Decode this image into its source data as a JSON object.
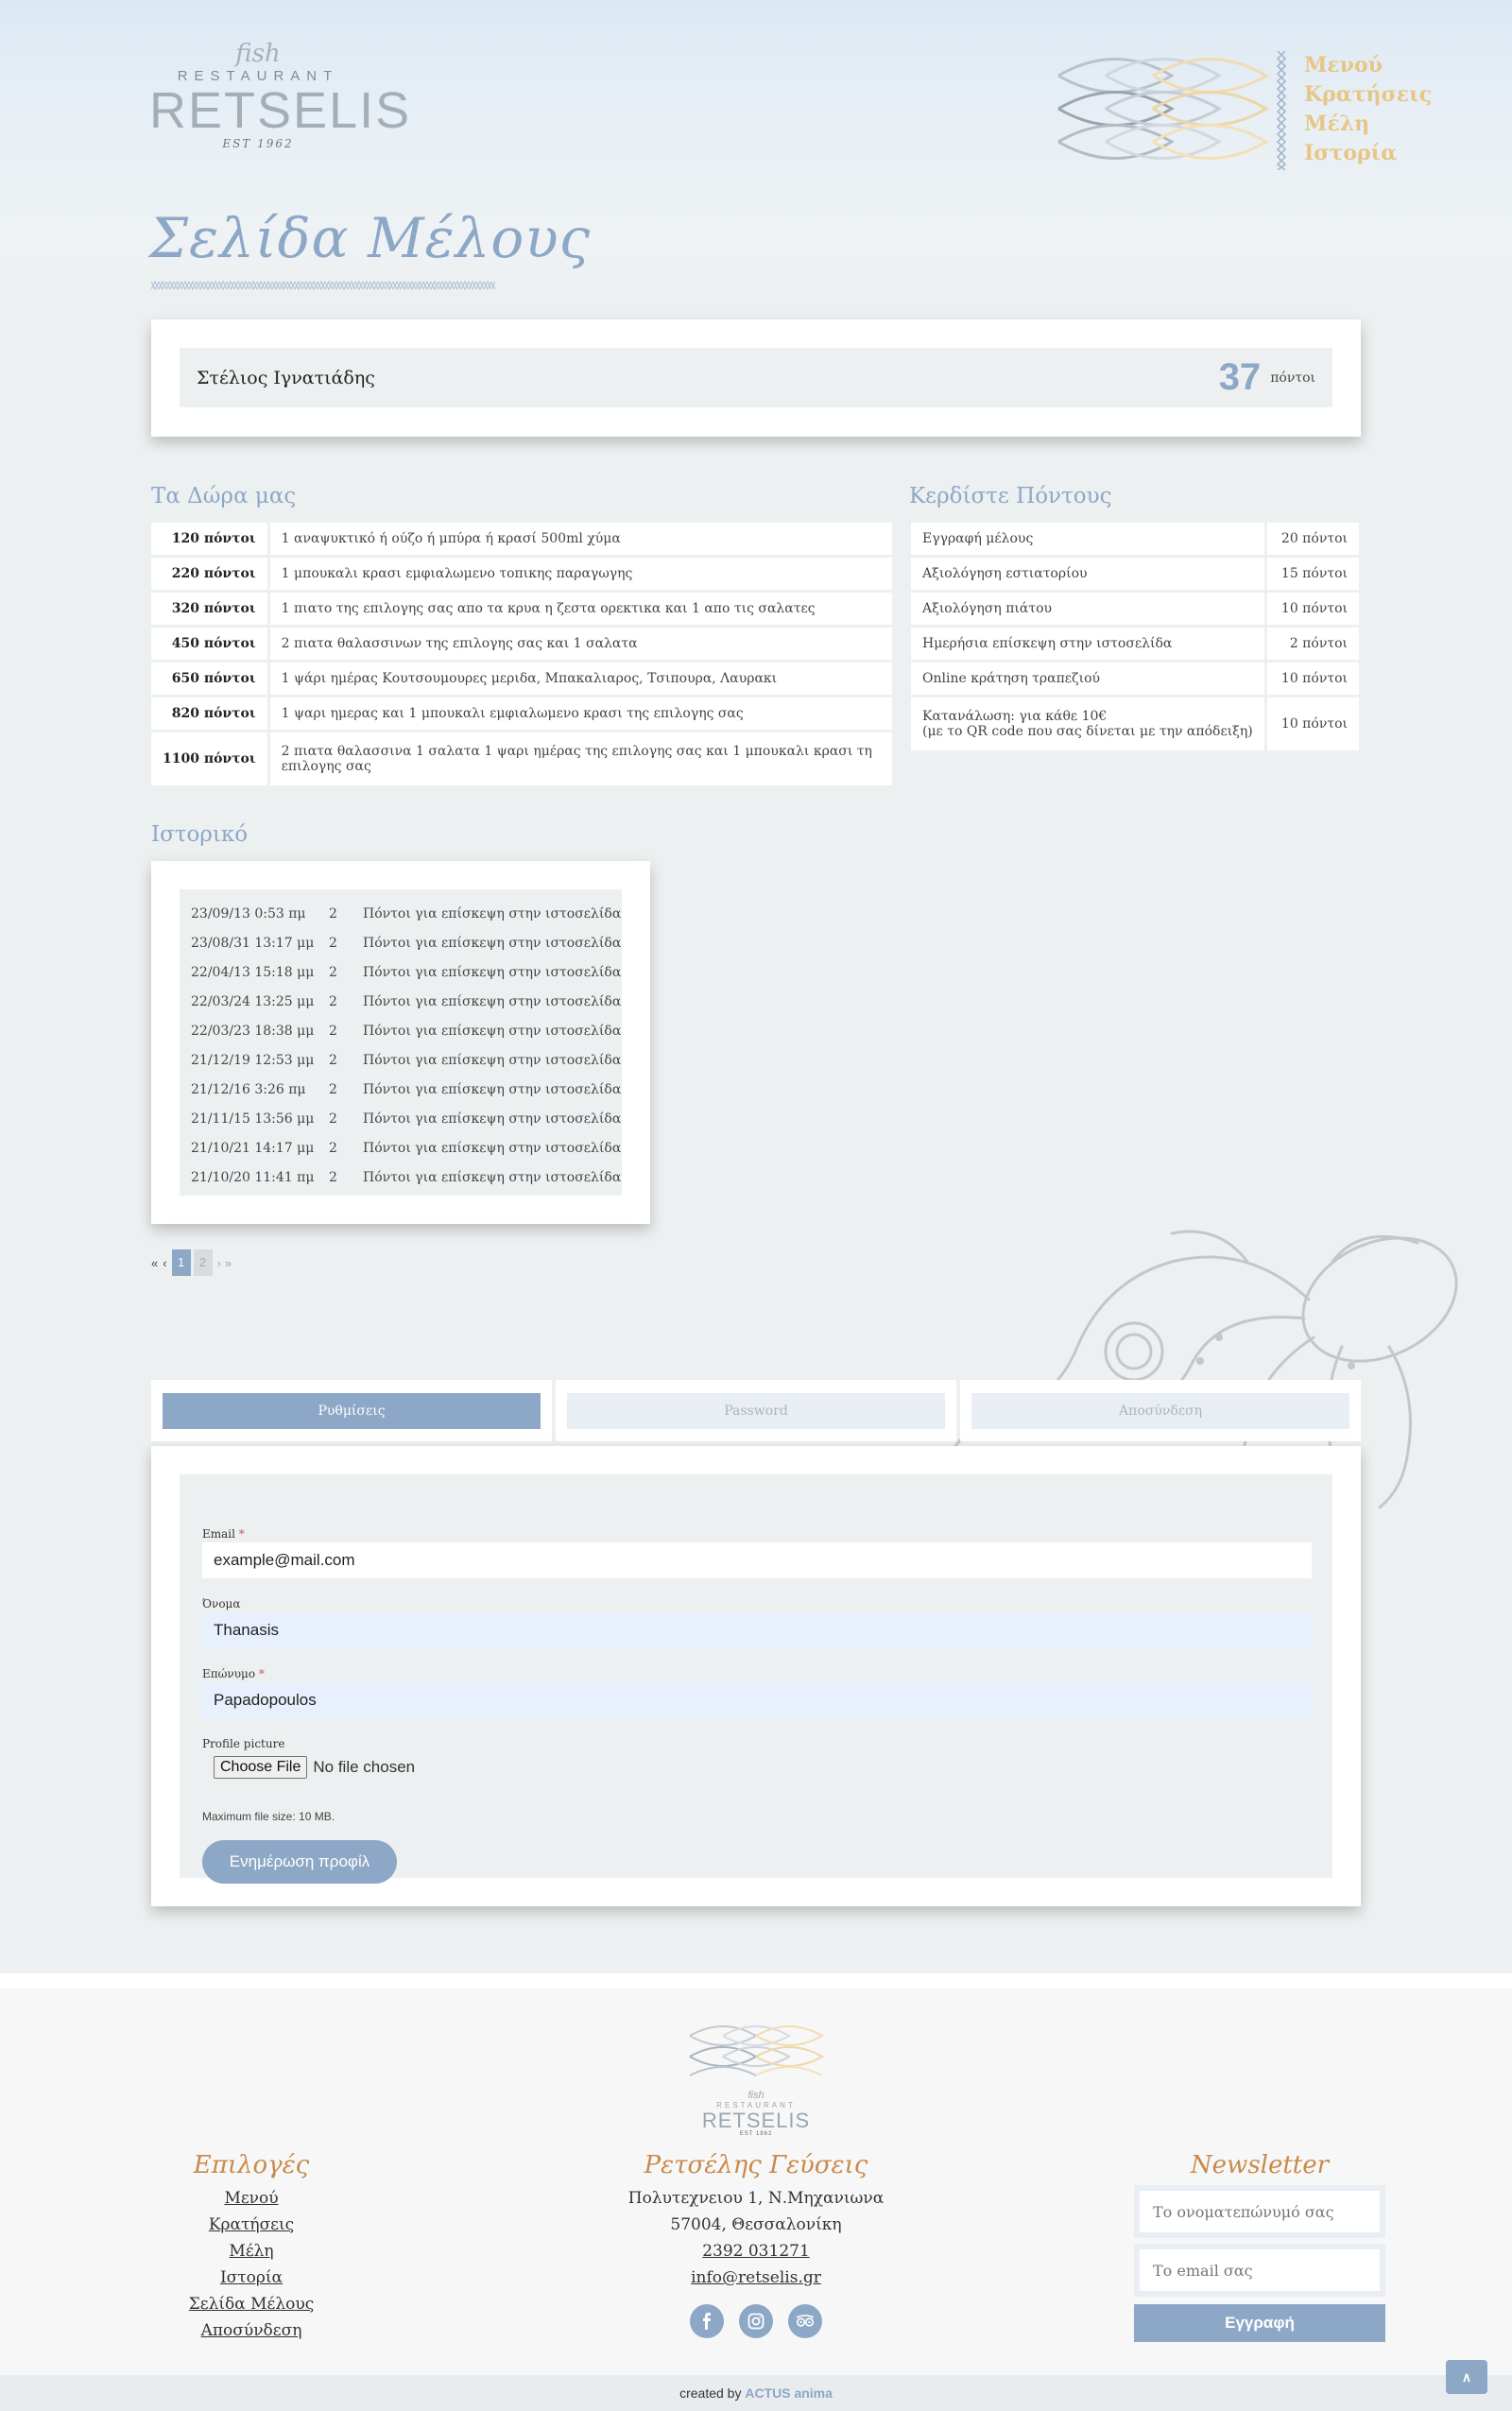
{
  "header": {
    "logo": {
      "fish": "fish",
      "restaurant": "RESTAURANT",
      "name": "RETSELIS",
      "est": "EST 1962"
    },
    "nav": [
      "Μενού",
      "Κρατήσεις",
      "Μέλη",
      "Ιστορία"
    ]
  },
  "page_title": "Σελίδα Μέλους",
  "member": {
    "name": "Στέλιος Ιγνατιάδης",
    "points": "37",
    "points_unit": "πόντοι"
  },
  "gifts": {
    "title": "Τα Δώρα μας",
    "rows": [
      {
        "points": "120 πόντοι",
        "desc": "1 αναψυκτικό ή ούζο ή μπύρα ή κρασί 500ml χύμα"
      },
      {
        "points": "220 πόντοι",
        "desc": "1 μπουκαλι κρασι εμφιαλωμενο τοπικης παραγωγης"
      },
      {
        "points": "320 πόντοι",
        "desc": "1 πιατο της επιλογης σας απο τα κρυα η ζεστα ορεκτικα και 1 απο τις σαλατες"
      },
      {
        "points": "450 πόντοι",
        "desc": "2 πιατα θαλασσινων της επιλογης σας και 1 σαλατα"
      },
      {
        "points": "650 πόντοι",
        "desc": "1 ψάρι ημέρας Κουτσουμουρες μεριδα, Μπακαλιαρος, Τσιπουρα, Λαυρακι"
      },
      {
        "points": "820 πόντοι",
        "desc": "1 ψαρι ημερας και 1 μπουκαλι εμφιαλωμενο κρασι της επιλογης σας"
      },
      {
        "points": "1100 πόντοι",
        "desc": "2 πιατα θαλασσινα 1 σαλατα 1 ψαρι ημέρας της επιλογης σας και 1 μπουκαλι κρασι τη επιλογης σας"
      }
    ]
  },
  "earn": {
    "title": "Κερδίστε Πόντους",
    "rows": [
      {
        "desc": "Εγγραφή μέλους",
        "desc2": "",
        "points": "20 πόντοι"
      },
      {
        "desc": "Αξιολόγηση εστιατορίου",
        "desc2": "",
        "points": "15 πόντοι"
      },
      {
        "desc": "Αξιολόγηση πιάτου",
        "desc2": "",
        "points": "10 πόντοι"
      },
      {
        "desc": "Ημερήσια επίσκεψη στην ιστοσελίδα",
        "desc2": "",
        "points": "2 πόντοι"
      },
      {
        "desc": "Online κράτηση τραπεζιού",
        "desc2": "",
        "points": "10 πόντοι"
      },
      {
        "desc": "Κατανάλωση: για κάθε 10€",
        "desc2": "(με το QR code που σας δίνεται με την απόδειξη)",
        "points": "10 πόντοι"
      }
    ]
  },
  "history": {
    "title": "Ιστορικό",
    "rows": [
      {
        "date": "23/09/13 0:53 πμ",
        "points": "2",
        "desc": "Πόντοι για επίσκεψη στην ιστοσελίδα"
      },
      {
        "date": "23/08/31 13:17 μμ",
        "points": "2",
        "desc": "Πόντοι για επίσκεψη στην ιστοσελίδα"
      },
      {
        "date": "22/04/13 15:18 μμ",
        "points": "2",
        "desc": "Πόντοι για επίσκεψη στην ιστοσελίδα"
      },
      {
        "date": "22/03/24 13:25 μμ",
        "points": "2",
        "desc": "Πόντοι για επίσκεψη στην ιστοσελίδα"
      },
      {
        "date": "22/03/23 18:38 μμ",
        "points": "2",
        "desc": "Πόντοι για επίσκεψη στην ιστοσελίδα"
      },
      {
        "date": "21/12/19 12:53 μμ",
        "points": "2",
        "desc": "Πόντοι για επίσκεψη στην ιστοσελίδα"
      },
      {
        "date": "21/12/16 3:26 πμ",
        "points": "2",
        "desc": "Πόντοι για επίσκεψη στην ιστοσελίδα"
      },
      {
        "date": "21/11/15 13:56 μμ",
        "points": "2",
        "desc": "Πόντοι για επίσκεψη στην ιστοσελίδα"
      },
      {
        "date": "21/10/21 14:17 μμ",
        "points": "2",
        "desc": "Πόντοι για επίσκεψη στην ιστοσελίδα"
      },
      {
        "date": "21/10/20 11:41 πμ",
        "points": "2",
        "desc": "Πόντοι για επίσκεψη στην ιστοσελίδα"
      }
    ]
  },
  "pager": {
    "first": "«",
    "prev": "‹",
    "current": "1",
    "next_page": "2",
    "next": "›",
    "last": "»"
  },
  "tabs": [
    "Ρυθμίσεις",
    "Password",
    "Αποσύνδεση"
  ],
  "form": {
    "email": {
      "label": "Email",
      "required": "*",
      "value": "example@mail.com"
    },
    "name": {
      "label": "Όνομα",
      "value": "Thanasis"
    },
    "surname": {
      "label": "Επώνυμο",
      "required": "*",
      "value": "Papadopoulos"
    },
    "picture": {
      "label": "Profile picture",
      "button": "Choose File",
      "status": "No file chosen"
    },
    "file_note": "Maximum file size: 10 MB.",
    "submit": "Ενημέρωση προφίλ"
  },
  "footer": {
    "options": {
      "title": "Επιλογές",
      "links": [
        "Μενού",
        "Κρατήσεις",
        "Μέλη",
        "Ιστορία",
        "Σελίδα Μέλους",
        "Αποσύνδεση"
      ]
    },
    "contact": {
      "title": "Ρετσέλης Γεύσεις",
      "address1": "Πολυτεχνειου 1, Ν.Μηχανιωνα",
      "address2": "57004, Θεσσαλονίκη",
      "phone": "2392 031271",
      "email": "info@retselis.gr"
    },
    "newsletter": {
      "title": "Newsletter",
      "name_placeholder": "Το ονοματεπώνυμό σας",
      "email_placeholder": "Το email σας",
      "button": "Εγγραφή"
    },
    "logo": {
      "fish": "fish",
      "restaurant": "RESTAURANT",
      "name": "RETSELIS",
      "est": "EST 1962"
    },
    "credit_prefix": "created by",
    "credit_brand": "ACTUS anima",
    "to_top": "∧"
  },
  "colors": {
    "accent": "#8da7c6",
    "nav": "#e7c685",
    "footer_heading": "#c88a4b"
  }
}
